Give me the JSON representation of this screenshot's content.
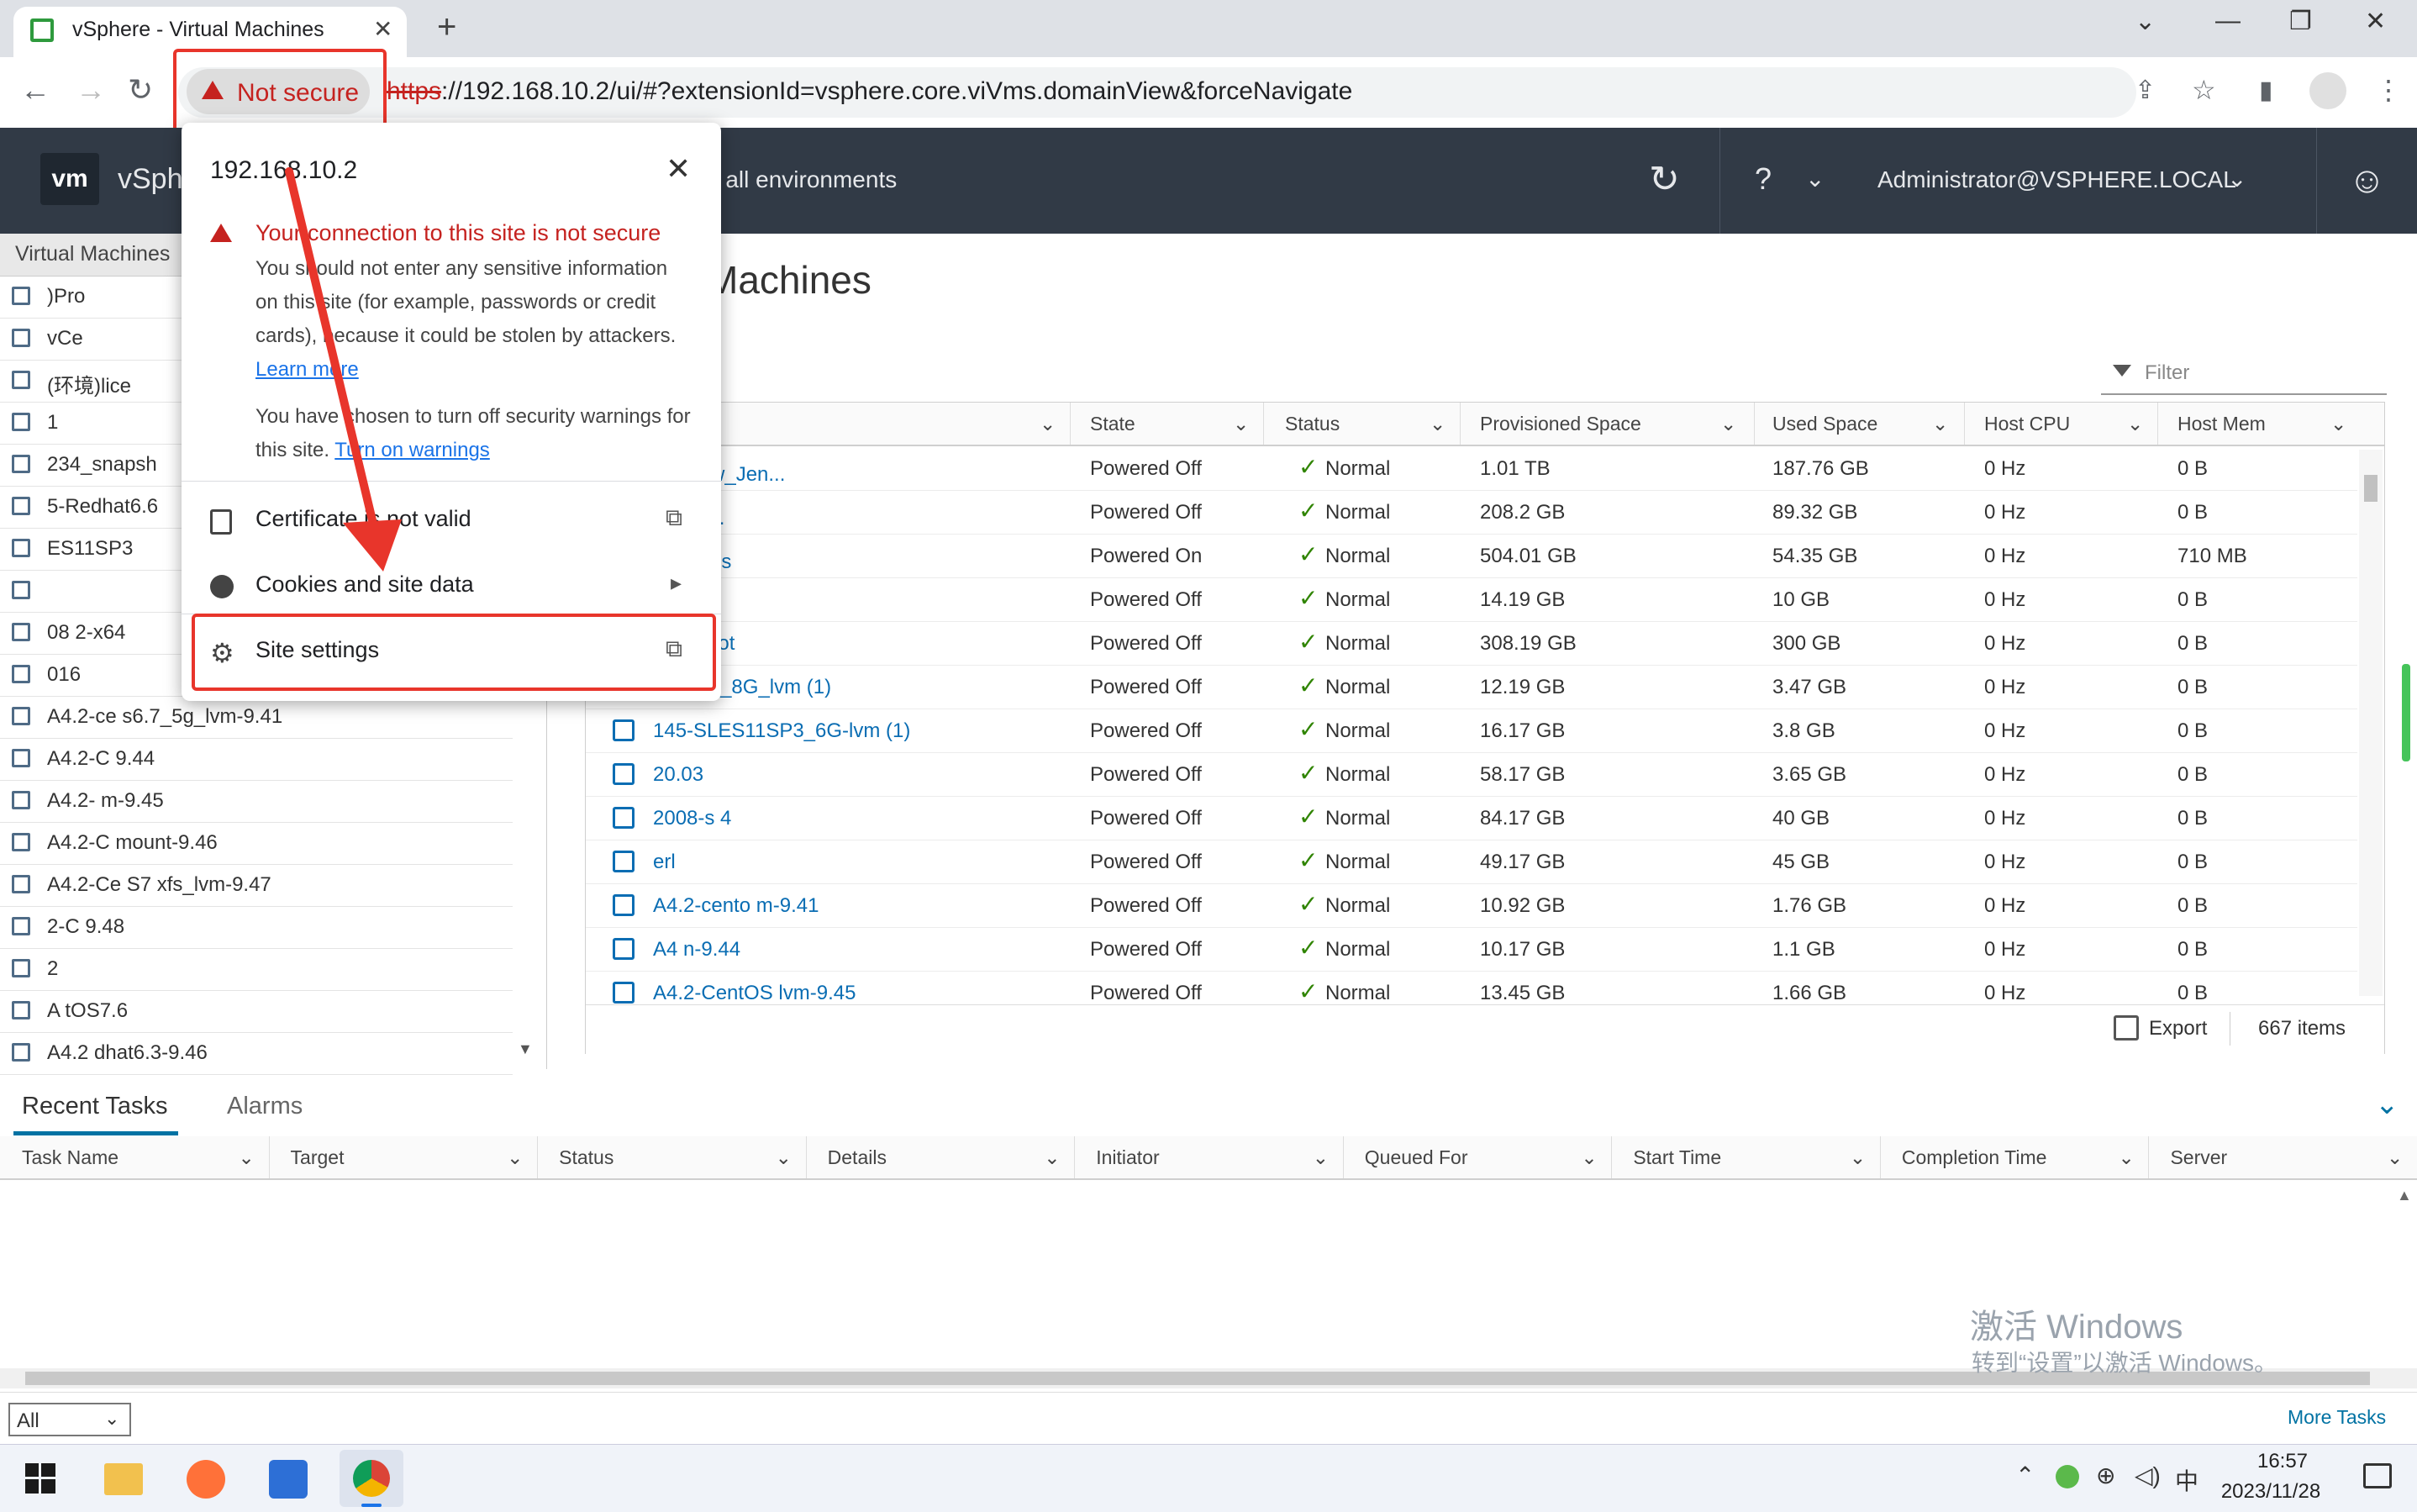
{
  "browser": {
    "tab_title": "vSphere - Virtual Machines",
    "not_secure_label": "Not secure",
    "url_scheme": "https",
    "url_rest": "://192.168.10.2/ui/#?extensionId=vsphere.core.viVms.domainView&forceNavigate"
  },
  "header": {
    "logo": "vm",
    "brand_partial": "vSph",
    "search_partial": "n all environments",
    "user": "Administrator@VSPHERE.LOCAL"
  },
  "navigator": {
    "title": "Virtual Machines",
    "items": [
      {
        "label": ")Pro"
      },
      {
        "label": "vCe"
      },
      {
        "label": "(环境)lice"
      },
      {
        "label": "1"
      },
      {
        "label": "234_snapsh"
      },
      {
        "label": "5-Redhat6.6"
      },
      {
        "label": "ES11SP3"
      },
      {
        "label": ""
      },
      {
        "label": "08   2-x64"
      },
      {
        "label": "016"
      },
      {
        "label": "A4.2-ce   s6.7_5g_lvm-9.41"
      },
      {
        "label": "A4.2-C                     9.44"
      },
      {
        "label": "A4.2-                      m-9.45"
      },
      {
        "label": "A4.2-C                     mount-9.46"
      },
      {
        "label": "A4.2-Ce    S7   xfs_lvm-9.47"
      },
      {
        "label": "2-C                        9.48"
      },
      {
        "label": "2"
      },
      {
        "label": "A      tOS7.6"
      },
      {
        "label": "A4.2   dhat6.3-9.46"
      }
    ]
  },
  "main": {
    "title": "Machines",
    "filter_placeholder": "Filter",
    "columns": [
      "State",
      "Status",
      "Provisioned Space",
      "Used Space",
      "Host CPU",
      "Host Mem"
    ],
    "rows": [
      {
        "name": "用,            New_Jen...",
        "state": "Powered Off",
        "status": "Normal",
        "prov": "1.01 TB",
        "used": "187.76 GB",
        "cpu": "0 Hz",
        "mem": "0 B"
      },
      {
        "name": "用              er_...",
        "state": "Powered Off",
        "status": "Normal",
        "prov": "208.2 GB",
        "used": "89.32 GB",
        "cpu": "0 Hz",
        "mem": "0 B"
      },
      {
        "name": "境)licens",
        "state": "Powered On",
        "status": "Normal",
        "prov": "504.01 GB",
        "used": "54.35 GB",
        "cpu": "0 Hz",
        "mem": "710 MB"
      },
      {
        "name": "",
        "state": "Powered Off",
        "status": "Normal",
        "prov": "14.19 GB",
        "used": "10 GB",
        "cpu": "0 Hz",
        "mem": "0 B"
      },
      {
        "name": "snapshot",
        "state": "Powered Off",
        "status": "Normal",
        "prov": "308.19 GB",
        "used": "300 GB",
        "cpu": "0 Hz",
        "mem": "0 B"
      },
      {
        "name": "dhat6.6_8G_lvm (1)",
        "state": "Powered Off",
        "status": "Normal",
        "prov": "12.19 GB",
        "used": "3.47 GB",
        "cpu": "0 Hz",
        "mem": "0 B"
      },
      {
        "name": "145-SLES11SP3_6G-lvm (1)",
        "state": "Powered Off",
        "status": "Normal",
        "prov": "16.17 GB",
        "used": "3.8 GB",
        "cpu": "0 Hz",
        "mem": "0 B"
      },
      {
        "name": "20.03",
        "state": "Powered Off",
        "status": "Normal",
        "prov": "58.17 GB",
        "used": "3.65 GB",
        "cpu": "0 Hz",
        "mem": "0 B"
      },
      {
        "name": "2008-s   4",
        "state": "Powered Off",
        "status": "Normal",
        "prov": "84.17 GB",
        "used": "40 GB",
        "cpu": "0 Hz",
        "mem": "0 B"
      },
      {
        "name": "erl",
        "state": "Powered Off",
        "status": "Normal",
        "prov": "49.17 GB",
        "used": "45 GB",
        "cpu": "0 Hz",
        "mem": "0 B"
      },
      {
        "name": "A4.2-cento       m-9.41",
        "state": "Powered Off",
        "status": "Normal",
        "prov": "10.92 GB",
        "used": "1.76 GB",
        "cpu": "0 Hz",
        "mem": "0 B"
      },
      {
        "name": "A4            n-9.44",
        "state": "Powered Off",
        "status": "Normal",
        "prov": "10.17 GB",
        "used": "1.1 GB",
        "cpu": "0 Hz",
        "mem": "0 B"
      },
      {
        "name": "A4.2-CentOS       lvm-9.45",
        "state": "Powered Off",
        "status": "Normal",
        "prov": "13.45 GB",
        "used": "1.66 GB",
        "cpu": "0 Hz",
        "mem": "0 B"
      }
    ],
    "export_label": "Export",
    "items_count": "667 items"
  },
  "tasks": {
    "tab_recent": "Recent Tasks",
    "tab_alarms": "Alarms",
    "columns": [
      "Task Name",
      "Target",
      "Status",
      "Details",
      "Initiator",
      "Queued For",
      "Start Time",
      "Completion Time",
      "Server"
    ],
    "filter_value": "All",
    "more_tasks": "More Tasks"
  },
  "popup": {
    "host": "192.168.10.2",
    "warning_title": "Your connection to this site is not secure",
    "warning_body": "You should not enter any sensitive information on this site (for example, passwords or credit cards), because it could be stolen by attackers.",
    "learn_more": "Learn more",
    "chosen_body": "You have chosen to turn off security warnings for this site.",
    "turn_on_warnings": "Turn on warnings",
    "certificate": "Certificate is not valid",
    "cookies": "Cookies and site data",
    "site_settings": "Site settings"
  },
  "watermark": {
    "line1": "激活 Windows",
    "line2": "转到“设置”以激活 Windows。"
  },
  "taskbar": {
    "ime": "中",
    "time": "16:57",
    "date": "2023/11/28"
  }
}
